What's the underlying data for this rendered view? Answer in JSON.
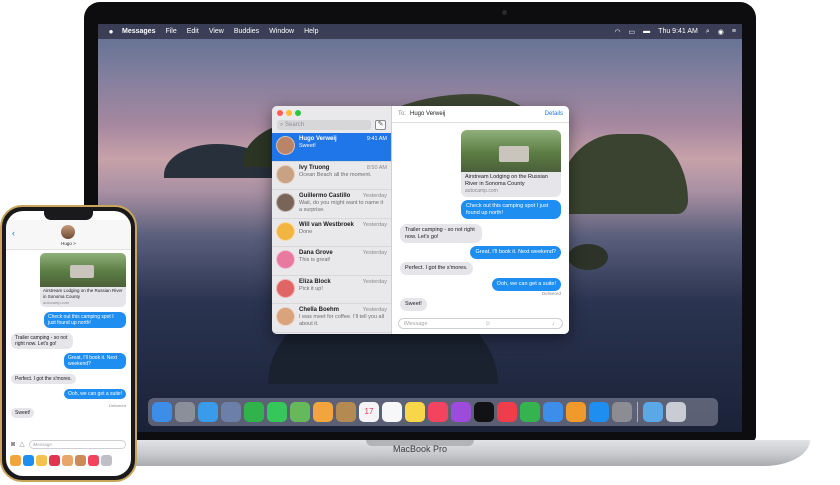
{
  "macbook": {
    "label": "MacBook Pro",
    "menubar": {
      "app_name": "Messages",
      "menus": [
        "File",
        "Edit",
        "View",
        "Buddies",
        "Window",
        "Help"
      ],
      "clock": "Thu 9:41 AM"
    },
    "messages_window": {
      "search_placeholder": "Search",
      "conversations": [
        {
          "name": "Hugo Verweij",
          "time": "9:41 AM",
          "preview": "Sweet!",
          "active": true,
          "avatar_color": "#b98468"
        },
        {
          "name": "Ivy Truong",
          "time": "8:50 AM",
          "preview": "Ocean Beach all the moment.",
          "active": false,
          "avatar_color": "#c9a183"
        },
        {
          "name": "Guillermo Castillo",
          "time": "Yesterday",
          "preview": "Wait, do you might want to name it a surprise.",
          "active": false,
          "avatar_color": "#7a6458"
        },
        {
          "name": "Will van Westbroek",
          "time": "Yesterday",
          "preview": "Done",
          "active": false,
          "avatar_color": "#f2b542"
        },
        {
          "name": "Dana Grove",
          "time": "Yesterday",
          "preview": "This is great!",
          "active": false,
          "avatar_color": "#e87aa0"
        },
        {
          "name": "Eliza Block",
          "time": "Yesterday",
          "preview": "Pick it up!",
          "active": false,
          "avatar_color": "#e06565"
        },
        {
          "name": "Chella Boehm",
          "time": "Yesterday",
          "preview": "I was meet for coffee. I'll tell you all about it.",
          "active": false,
          "avatar_color": "#d9a37c"
        }
      ],
      "to_label": "To:",
      "to_name": "Hugo Verweij",
      "details_label": "Details",
      "link_card": {
        "title": "Airstream Lodging on the Russian River in Sonoma County",
        "domain": "autocamp.com"
      },
      "messages": [
        {
          "dir": "out",
          "text": "Check out this camping spot I just found up north!"
        },
        {
          "dir": "in",
          "text": "Trailer camping - so not right now. Let's go!"
        },
        {
          "dir": "out",
          "text": "Great, I'll book it. Next weekend?"
        },
        {
          "dir": "in",
          "text": "Perfect. I got the s'mores."
        },
        {
          "dir": "out",
          "text": "Ooh, we can get a suite!"
        },
        {
          "dir": "in",
          "text": "Sweet!"
        }
      ],
      "delivered_label": "Delivered",
      "input_placeholder": "iMessage"
    },
    "dock": [
      {
        "name": "finder",
        "color": "#3d8ee8"
      },
      {
        "name": "launchpad",
        "color": "#8a8f9a"
      },
      {
        "name": "safari",
        "color": "#3a9bea"
      },
      {
        "name": "photos-browser",
        "color": "#6b7fa8"
      },
      {
        "name": "facetime",
        "color": "#2fb34a"
      },
      {
        "name": "messages",
        "color": "#35c75a"
      },
      {
        "name": "maps",
        "color": "#65b95a"
      },
      {
        "name": "photos",
        "color": "#f2a53c"
      },
      {
        "name": "notes-book",
        "color": "#b58a52"
      },
      {
        "name": "calendar",
        "color": "#f4f4f6"
      },
      {
        "name": "reminders",
        "color": "#f7f7f9"
      },
      {
        "name": "notes",
        "color": "#f7d64a"
      },
      {
        "name": "music",
        "color": "#f2445f"
      },
      {
        "name": "podcasts",
        "color": "#9d4bdc"
      },
      {
        "name": "apple-tv",
        "color": "#121214"
      },
      {
        "name": "news",
        "color": "#ef3d4c"
      },
      {
        "name": "numbers",
        "color": "#35b34f"
      },
      {
        "name": "keynote",
        "color": "#3c8eea"
      },
      {
        "name": "pages",
        "color": "#f09a2c"
      },
      {
        "name": "app-store",
        "color": "#1f8ef1"
      },
      {
        "name": "system-preferences",
        "color": "#8b8d93"
      },
      {
        "name": "downloads-folder",
        "color": "#5ba8e6"
      },
      {
        "name": "trash",
        "color": "#c9ccd2"
      }
    ],
    "calendar_day": "17"
  },
  "iphone": {
    "contact_name": "Hugo >",
    "link_card": {
      "title": "Airstream Lodging on the Russian River in Sonoma County",
      "domain": "autocamp.com"
    },
    "messages": [
      {
        "dir": "out",
        "text": "Check out this camping spot I just found up north!"
      },
      {
        "dir": "in",
        "text": "Trailer camping - so not right now. Let's go!"
      },
      {
        "dir": "out",
        "text": "Great, I'll book it. Next weekend?"
      },
      {
        "dir": "in",
        "text": "Perfect. I got the s'mores."
      },
      {
        "dir": "out",
        "text": "Ooh, we can get a suite!"
      },
      {
        "dir": "in",
        "text": "Sweet!"
      }
    ],
    "delivered_label": "Delivered",
    "input_placeholder": "iMessage",
    "app_strip": [
      {
        "name": "photos",
        "color": "#f2a53c"
      },
      {
        "name": "app-store",
        "color": "#1f8ef1"
      },
      {
        "name": "memoji",
        "color": "#f4c24a"
      },
      {
        "name": "digital-touch",
        "color": "#e0364d"
      },
      {
        "name": "animoji",
        "color": "#e9a66b"
      },
      {
        "name": "memoji-2",
        "color": "#c98a5c"
      },
      {
        "name": "music",
        "color": "#f2445f"
      },
      {
        "name": "more",
        "color": "#bfbfc5"
      }
    ]
  }
}
